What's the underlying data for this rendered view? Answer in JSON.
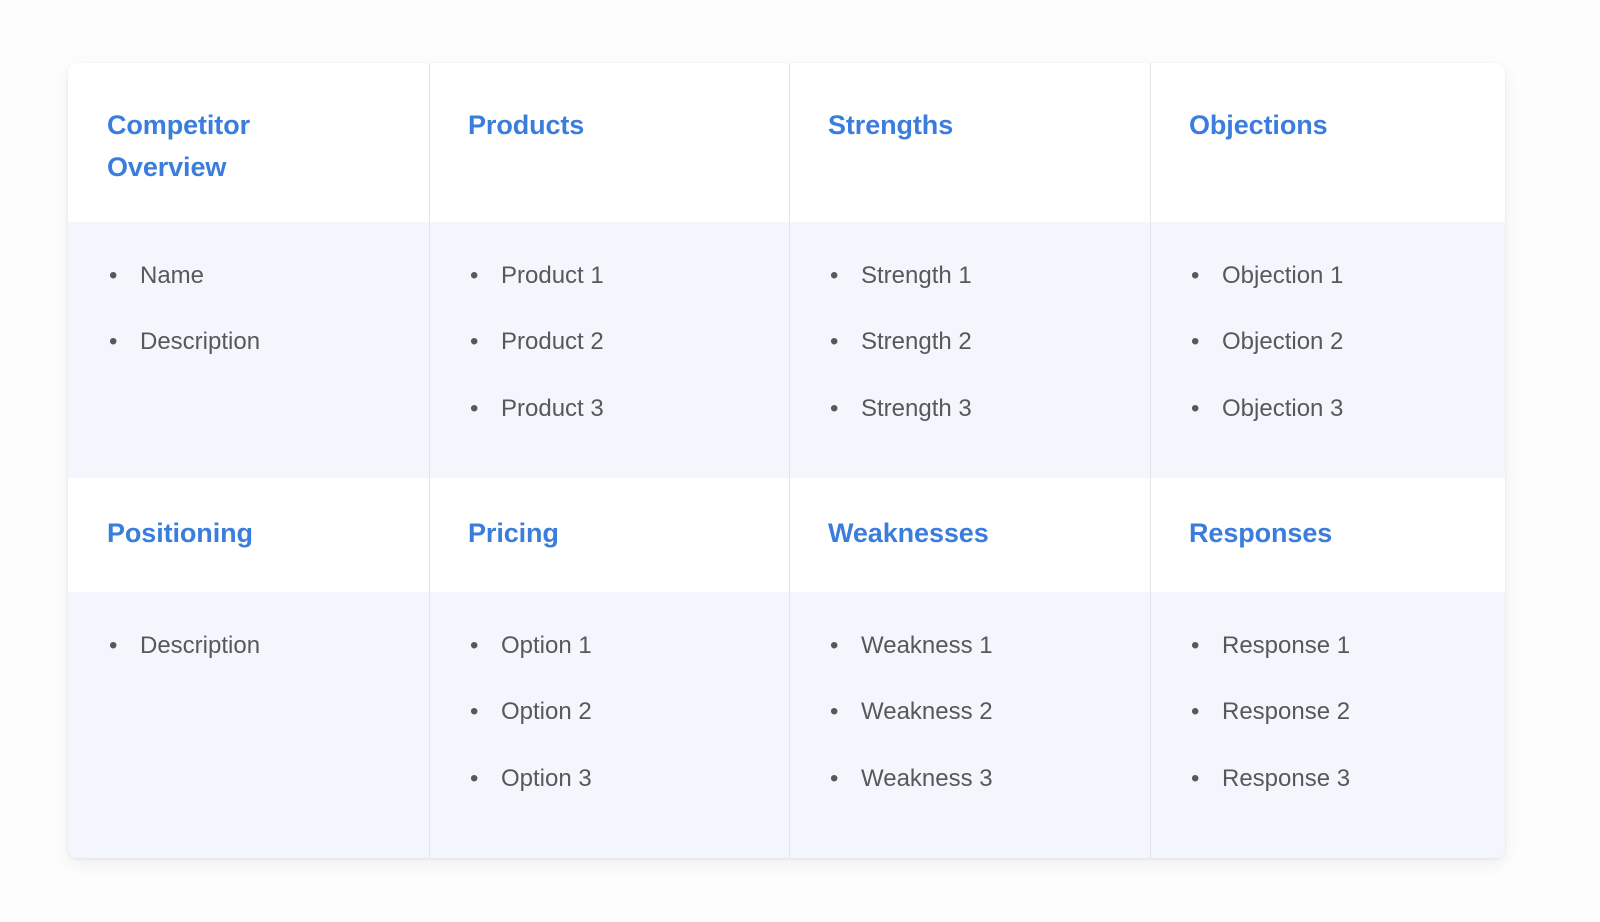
{
  "card": {
    "accent_color": "#3b7ddd",
    "text_color": "#585858",
    "header_band_color": "#ffffff",
    "body_band_color": "#f3f7fd",
    "divider_color": "#e4e5e8",
    "bullet_glyph": "•"
  },
  "rows": [
    {
      "columns": [
        {
          "header": "Competitor\nOverview",
          "items": [
            "Name",
            "Description"
          ]
        },
        {
          "header": "Products",
          "items": [
            "Product 1",
            "Product 2",
            "Product 3"
          ]
        },
        {
          "header": "Strengths",
          "items": [
            "Strength 1",
            "Strength 2",
            "Strength 3"
          ]
        },
        {
          "header": "Objections",
          "items": [
            "Objection 1",
            "Objection 2",
            "Objection 3"
          ]
        }
      ]
    },
    {
      "columns": [
        {
          "header": "Positioning",
          "items": [
            "Description"
          ]
        },
        {
          "header": "Pricing",
          "items": [
            "Option 1",
            "Option 2",
            "Option 3"
          ]
        },
        {
          "header": "Weaknesses",
          "items": [
            "Weakness 1",
            "Weakness 2",
            "Weakness 3"
          ]
        },
        {
          "header": "Responses",
          "items": [
            "Response 1",
            "Response 2",
            "Response 3"
          ]
        }
      ]
    }
  ]
}
